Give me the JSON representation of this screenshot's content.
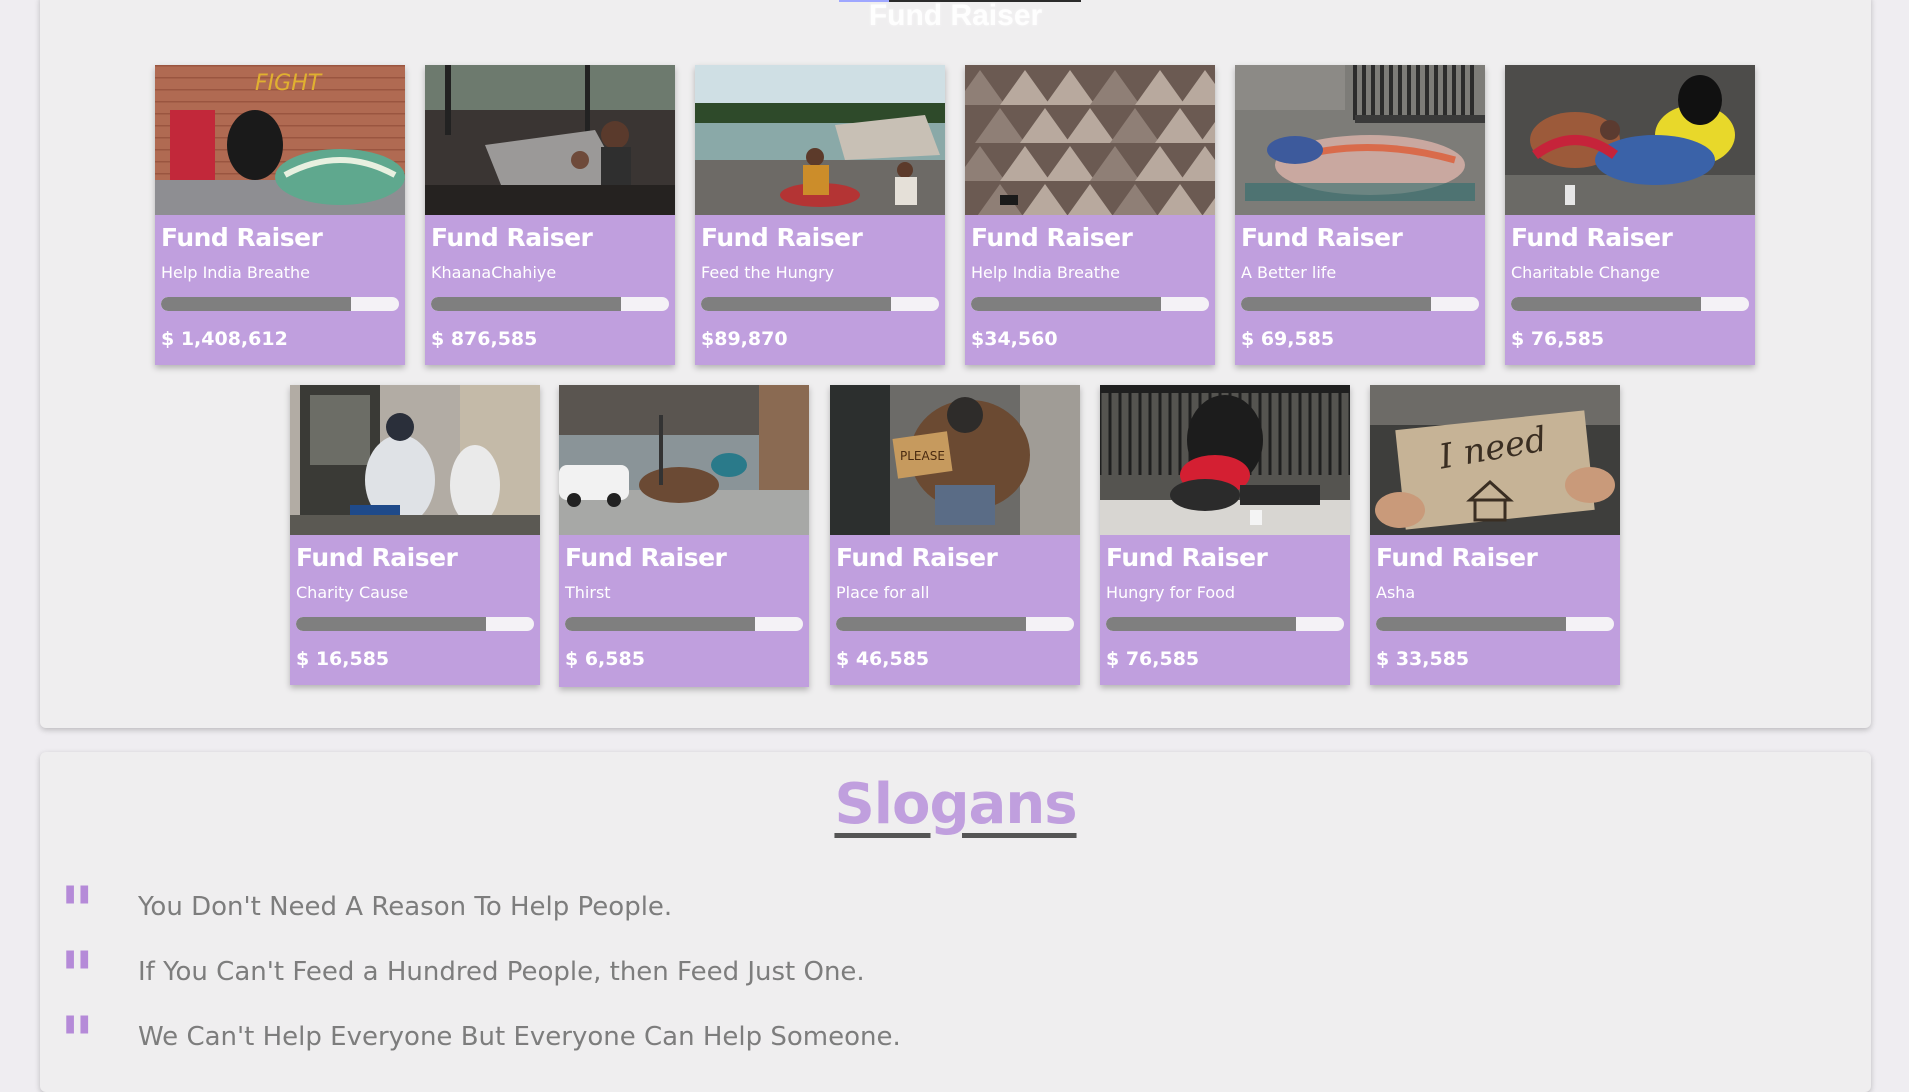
{
  "section_title": "Fund Raiser",
  "cards": [
    {
      "title": "Fund Raiser",
      "subtitle": "Help India Breathe",
      "amount": "$ 1,408,612",
      "progress": 0.8,
      "photo": "photo-street-belongings"
    },
    {
      "title": "Fund Raiser",
      "subtitle": "KhaanaChahiye",
      "amount": "$ 876,585",
      "progress": 0.8,
      "photo": "photo-burnt-slum"
    },
    {
      "title": "Fund Raiser",
      "subtitle": "Feed the Hungry",
      "amount": "$89,870",
      "progress": 0.8,
      "photo": "photo-flood-camp"
    },
    {
      "title": "Fund Raiser",
      "subtitle": "Help India Breathe",
      "amount": "$34,560",
      "progress": 0.8,
      "photo": "photo-tent-camp"
    },
    {
      "title": "Fund Raiser",
      "subtitle": "A Better life",
      "amount": "$ 69,585",
      "progress": 0.8,
      "photo": "photo-sleeping-sidewalk"
    },
    {
      "title": "Fund Raiser",
      "subtitle": "Charitable Change",
      "amount": "$ 76,585",
      "progress": 0.8,
      "photo": "photo-sleeping-man"
    },
    {
      "title": "Fund Raiser",
      "subtitle": "Charity Cause",
      "amount": "$ 16,585",
      "progress": 0.8,
      "photo": "photo-doorway"
    },
    {
      "title": "Fund Raiser",
      "subtitle": "Thirst",
      "amount": "$ 6,585",
      "progress": 0.8,
      "photo": "photo-city-street"
    },
    {
      "title": "Fund Raiser",
      "subtitle": "Place for all",
      "amount": "$ 46,585",
      "progress": 0.8,
      "photo": "photo-sign-holder"
    },
    {
      "title": "Fund Raiser",
      "subtitle": "Hungry for Food",
      "amount": "$ 76,585",
      "progress": 0.8,
      "photo": "photo-man-with-dog"
    },
    {
      "title": "Fund Raiser",
      "subtitle": "Asha",
      "amount": "$ 33,585",
      "progress": 0.8,
      "photo": "photo-i-need-sign"
    }
  ],
  "slogans_section": {
    "title": "Slogans",
    "items": [
      {
        "quote_mark": "\"",
        "text": "You Don't Need A Reason To Help People."
      },
      {
        "quote_mark": "\"",
        "text": "If You Can't Feed a Hundred People, then Feed Just One."
      },
      {
        "quote_mark": "\"",
        "text": "We Can't Help Everyone But Everyone Can Help Someone."
      }
    ]
  },
  "colors": {
    "accent": "#c09fde",
    "quote": "#b58ad8",
    "progress_fill": "#7f7f7f"
  },
  "photo_sign_text": "I need"
}
